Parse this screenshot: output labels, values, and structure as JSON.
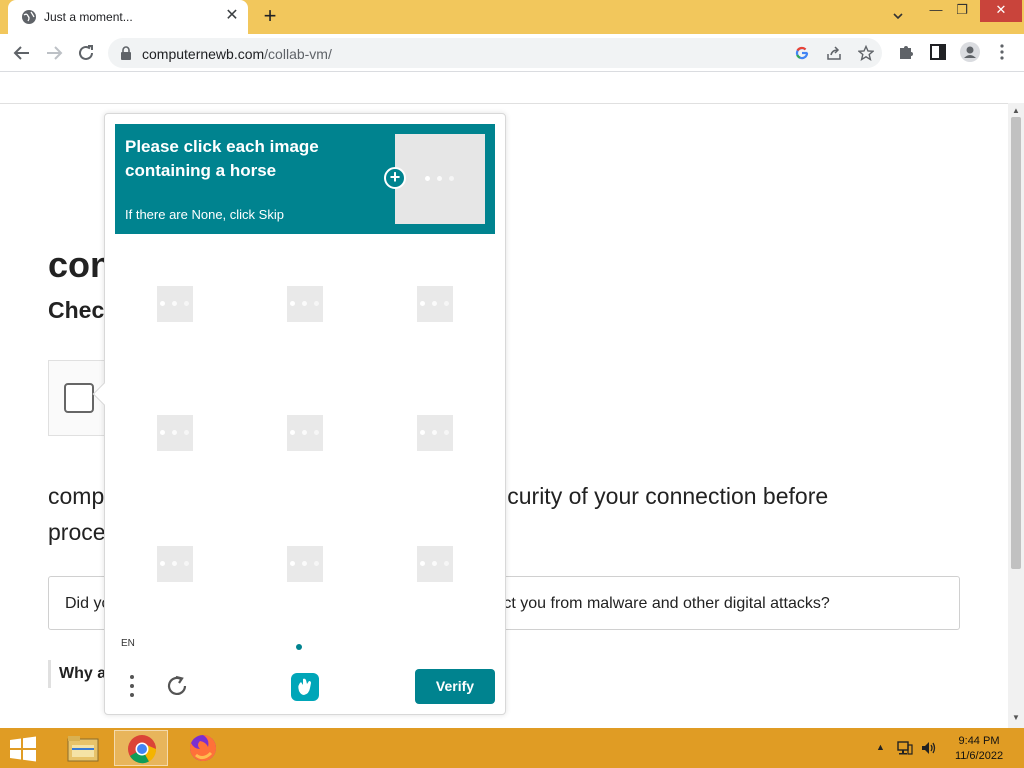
{
  "browser": {
    "tab_title": "Just a moment...",
    "new_tab_symbol": "+",
    "tab_close_symbol": "✕",
    "url_host": "computernewb.com",
    "url_path": "/collab-vm/",
    "window_controls": {
      "minimize": "—",
      "maximize": "❐",
      "close": "✕"
    }
  },
  "page": {
    "title": "con",
    "subtitle": "Checl",
    "body_left": "comp",
    "body_right": "curity of your connection before",
    "body_line2": "proce",
    "info_left": "Did yo",
    "info_right": "ct you from malware and other digital attacks?",
    "why_text": "Why a"
  },
  "captcha": {
    "prompt_line1": "Please click each image",
    "prompt_line2": "containing a horse",
    "prompt_hint": "If there are None, click Skip",
    "language": "EN",
    "verify_label": "Verify",
    "accent_color": "#00838f",
    "tile_count": 9
  },
  "taskbar": {
    "time": "9:44 PM",
    "date": "11/6/2022",
    "color": "#e09c24"
  }
}
